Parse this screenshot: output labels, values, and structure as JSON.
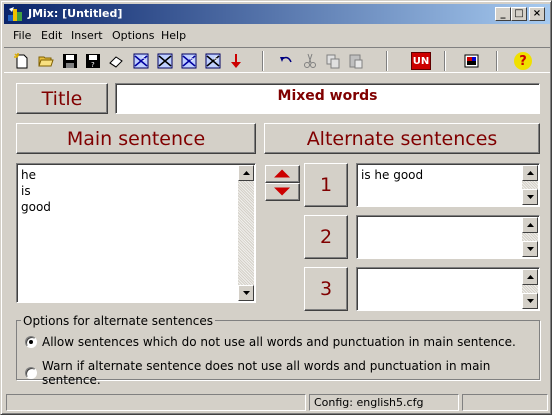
{
  "window": {
    "title": "JMix: [Untitled]",
    "controls": {
      "minimize": "_",
      "maximize": "□",
      "close": "×"
    }
  },
  "menu": [
    "File",
    "Edit",
    "Insert",
    "Options",
    "Help"
  ],
  "toolbar": {
    "icons": [
      "new-file-icon",
      "open-folder-icon",
      "save-icon",
      "save-as-icon",
      "eraser-icon",
      "web-page-icon-1",
      "web-page-icon-2",
      "web-page-icon-3",
      "web-page-icon-4",
      "red-down-arrow-icon",
      "undo-icon",
      "cut-icon",
      "copy-icon",
      "paste-icon",
      "unicode-icon",
      "hotpotatoes-icon",
      "help-icon"
    ],
    "unicode_label": "UN",
    "help_label": "?"
  },
  "title_section": {
    "label": "Title",
    "value": "Mixed words"
  },
  "main": {
    "header": "Main sentence",
    "lines": [
      "he",
      "is",
      "good"
    ]
  },
  "alternates": {
    "header": "Alternate sentences",
    "items": [
      {
        "number": "1",
        "value": "is he good"
      },
      {
        "number": "2",
        "value": ""
      },
      {
        "number": "3",
        "value": ""
      }
    ]
  },
  "options": {
    "legend": "Options for alternate sentences",
    "radios": [
      {
        "label": "Allow sentences which do not use all words and punctuation in main sentence.",
        "checked": true
      },
      {
        "label": "Warn if alternate sentence does not use all words and punctuation in main sentence.",
        "checked": false
      }
    ]
  },
  "status": {
    "config": "Config: english5.cfg"
  },
  "colors": {
    "accent": "#800000",
    "titlebar_start": "#0a246a",
    "titlebar_end": "#a6caf0",
    "arrow_red": "#cc0000"
  }
}
